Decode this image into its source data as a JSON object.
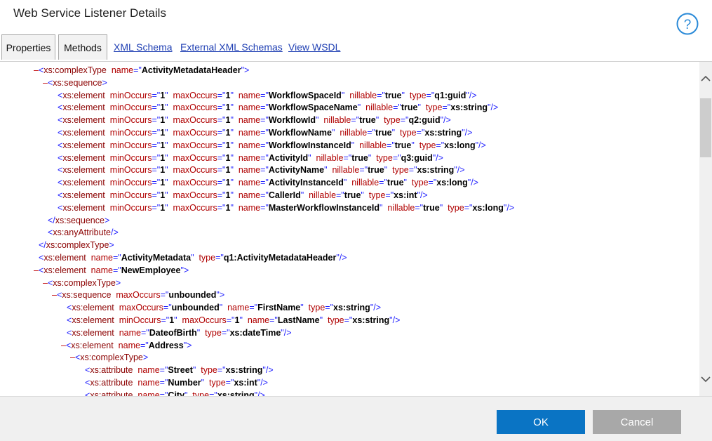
{
  "window": {
    "title": "Web Service Listener Details"
  },
  "tabs": {
    "properties": "Properties",
    "methods": "Methods",
    "xml_schema": "XML Schema",
    "external_xml_schemas": "External XML Schemas",
    "view_wsdl": "View WSDL"
  },
  "buttons": {
    "ok": "OK",
    "cancel": "Cancel"
  },
  "xml_lines": [
    {
      "toggle": "–",
      "close": false,
      "tag": "xs:complexType",
      "attrs": [
        [
          "name",
          "ActivityMetadataHeader"
        ]
      ],
      "end": ">"
    },
    {
      "toggle": "–",
      "close": false,
      "tag": "xs:sequence",
      "attrs": [],
      "end": ">"
    },
    {
      "toggle": "",
      "close": false,
      "tag": "xs:element",
      "attrs": [
        [
          "minOccurs",
          "1"
        ],
        [
          "maxOccurs",
          "1"
        ],
        [
          "name",
          "WorkflowSpaceId"
        ],
        [
          "nillable",
          "true"
        ],
        [
          "type",
          "q1:guid"
        ]
      ],
      "end": "/>"
    },
    {
      "toggle": "",
      "close": false,
      "tag": "xs:element",
      "attrs": [
        [
          "minOccurs",
          "1"
        ],
        [
          "maxOccurs",
          "1"
        ],
        [
          "name",
          "WorkflowSpaceName"
        ],
        [
          "nillable",
          "true"
        ],
        [
          "type",
          "xs:string"
        ]
      ],
      "end": "/>"
    },
    {
      "toggle": "",
      "close": false,
      "tag": "xs:element",
      "attrs": [
        [
          "minOccurs",
          "1"
        ],
        [
          "maxOccurs",
          "1"
        ],
        [
          "name",
          "WorkflowId"
        ],
        [
          "nillable",
          "true"
        ],
        [
          "type",
          "q2:guid"
        ]
      ],
      "end": "/>"
    },
    {
      "toggle": "",
      "close": false,
      "tag": "xs:element",
      "attrs": [
        [
          "minOccurs",
          "1"
        ],
        [
          "maxOccurs",
          "1"
        ],
        [
          "name",
          "WorkflowName"
        ],
        [
          "nillable",
          "true"
        ],
        [
          "type",
          "xs:string"
        ]
      ],
      "end": "/>"
    },
    {
      "toggle": "",
      "close": false,
      "tag": "xs:element",
      "attrs": [
        [
          "minOccurs",
          "1"
        ],
        [
          "maxOccurs",
          "1"
        ],
        [
          "name",
          "WorkflowInstanceId"
        ],
        [
          "nillable",
          "true"
        ],
        [
          "type",
          "xs:long"
        ]
      ],
      "end": "/>"
    },
    {
      "toggle": "",
      "close": false,
      "tag": "xs:element",
      "attrs": [
        [
          "minOccurs",
          "1"
        ],
        [
          "maxOccurs",
          "1"
        ],
        [
          "name",
          "ActivityId"
        ],
        [
          "nillable",
          "true"
        ],
        [
          "type",
          "q3:guid"
        ]
      ],
      "end": "/>"
    },
    {
      "toggle": "",
      "close": false,
      "tag": "xs:element",
      "attrs": [
        [
          "minOccurs",
          "1"
        ],
        [
          "maxOccurs",
          "1"
        ],
        [
          "name",
          "ActivityName"
        ],
        [
          "nillable",
          "true"
        ],
        [
          "type",
          "xs:string"
        ]
      ],
      "end": "/>"
    },
    {
      "toggle": "",
      "close": false,
      "tag": "xs:element",
      "attrs": [
        [
          "minOccurs",
          "1"
        ],
        [
          "maxOccurs",
          "1"
        ],
        [
          "name",
          "ActivityInstanceId"
        ],
        [
          "nillable",
          "true"
        ],
        [
          "type",
          "xs:long"
        ]
      ],
      "end": "/>"
    },
    {
      "toggle": "",
      "close": false,
      "tag": "xs:element",
      "attrs": [
        [
          "minOccurs",
          "1"
        ],
        [
          "maxOccurs",
          "1"
        ],
        [
          "name",
          "CallerId"
        ],
        [
          "nillable",
          "true"
        ],
        [
          "type",
          "xs:int"
        ]
      ],
      "end": "/>"
    },
    {
      "toggle": "",
      "close": false,
      "tag": "xs:element",
      "attrs": [
        [
          "minOccurs",
          "1"
        ],
        [
          "maxOccurs",
          "1"
        ],
        [
          "name",
          "MasterWorkflowInstanceId"
        ],
        [
          "nillable",
          "true"
        ],
        [
          "type",
          "xs:long"
        ]
      ],
      "end": "/>"
    },
    {
      "toggle": "",
      "close": true,
      "tag": "xs:sequence",
      "attrs": [],
      "end": ">"
    },
    {
      "toggle": "",
      "close": false,
      "tag": "xs:anyAttribute",
      "attrs": [],
      "end": "/>"
    },
    {
      "toggle": "",
      "close": true,
      "tag": "xs:complexType",
      "attrs": [],
      "end": ">"
    },
    {
      "toggle": "",
      "close": false,
      "tag": "xs:element",
      "attrs": [
        [
          "name",
          "ActivityMetadata"
        ],
        [
          "type",
          "q1:ActivityMetadataHeader"
        ]
      ],
      "end": "/>"
    },
    {
      "toggle": "–",
      "close": false,
      "tag": "xs:element",
      "attrs": [
        [
          "name",
          "NewEmployee"
        ]
      ],
      "end": ">"
    },
    {
      "toggle": "–",
      "close": false,
      "tag": "xs:complexType",
      "attrs": [],
      "end": ">"
    },
    {
      "toggle": "–",
      "close": false,
      "tag": "xs:sequence",
      "attrs": [
        [
          "maxOccurs",
          "unbounded"
        ]
      ],
      "end": ">"
    },
    {
      "toggle": "",
      "close": false,
      "tag": "xs:element",
      "attrs": [
        [
          "maxOccurs",
          "unbounded"
        ],
        [
          "name",
          "FirstName"
        ],
        [
          "type",
          "xs:string"
        ]
      ],
      "end": "/>"
    },
    {
      "toggle": "",
      "close": false,
      "tag": "xs:element",
      "attrs": [
        [
          "minOccurs",
          "1"
        ],
        [
          "maxOccurs",
          "1"
        ],
        [
          "name",
          "LastName"
        ],
        [
          "type",
          "xs:string"
        ]
      ],
      "end": "/>"
    },
    {
      "toggle": "",
      "close": false,
      "tag": "xs:element",
      "attrs": [
        [
          "name",
          "DateofBirth"
        ],
        [
          "type",
          "xs:dateTime"
        ]
      ],
      "end": "/>"
    },
    {
      "toggle": "–",
      "close": false,
      "tag": "xs:element",
      "attrs": [
        [
          "name",
          "Address"
        ]
      ],
      "end": ">"
    },
    {
      "toggle": "–",
      "close": false,
      "tag": "xs:complexType",
      "attrs": [],
      "end": ">"
    },
    {
      "toggle": "",
      "close": false,
      "tag": "xs:attribute",
      "attrs": [
        [
          "name",
          "Street"
        ],
        [
          "type",
          "xs:string"
        ]
      ],
      "end": "/>"
    },
    {
      "toggle": "",
      "close": false,
      "tag": "xs:attribute",
      "attrs": [
        [
          "name",
          "Number"
        ],
        [
          "type",
          "xs:int"
        ]
      ],
      "end": "/>"
    },
    {
      "toggle": "",
      "close": false,
      "tag": "xs:attribute",
      "attrs": [
        [
          "name",
          "City"
        ],
        [
          "type",
          "xs:string"
        ]
      ],
      "end": "/>"
    }
  ]
}
